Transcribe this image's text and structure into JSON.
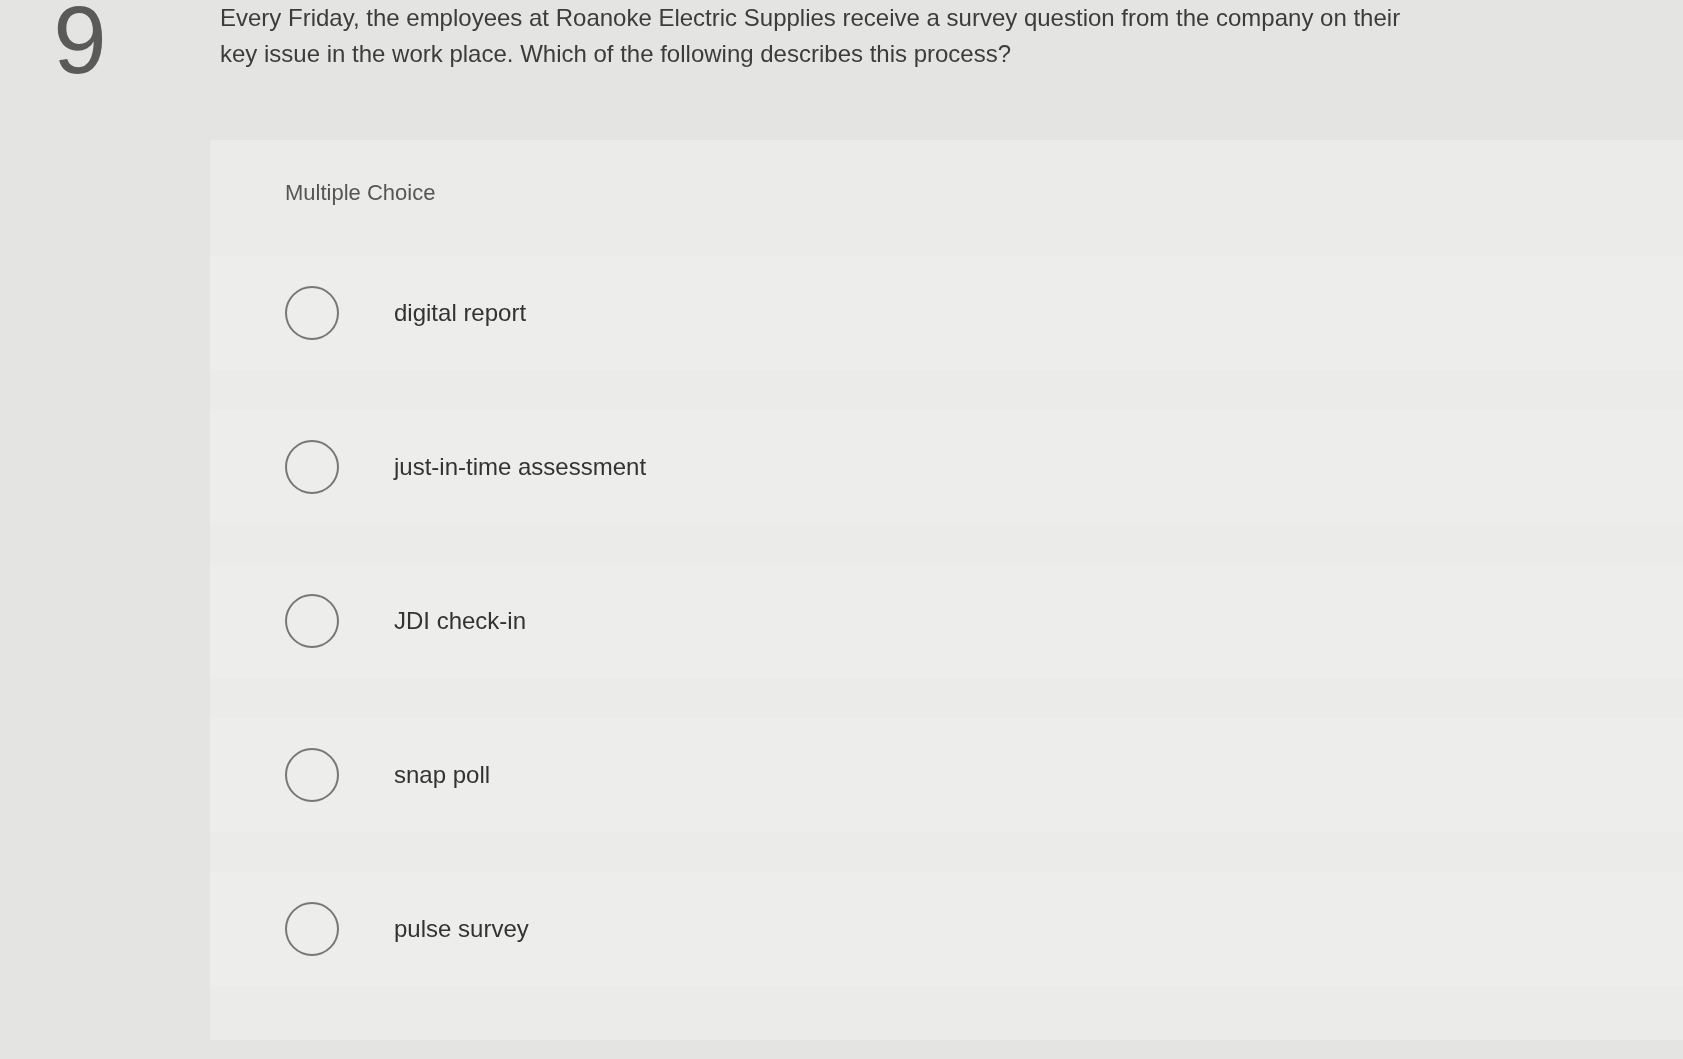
{
  "question": {
    "number": "9",
    "text_lines": [
      "Every Friday, the employees at Roanoke Electric Supplies receive a survey question from the company on their",
      "key issue in the work place. Which of the following describes this process?"
    ]
  },
  "answer_panel": {
    "heading": "Multiple Choice",
    "options": [
      {
        "label": "digital report",
        "selected": false
      },
      {
        "label": "just-in-time assessment",
        "selected": false
      },
      {
        "label": "JDI check-in",
        "selected": false
      },
      {
        "label": "snap poll",
        "selected": false
      },
      {
        "label": "pulse survey",
        "selected": false
      }
    ]
  }
}
